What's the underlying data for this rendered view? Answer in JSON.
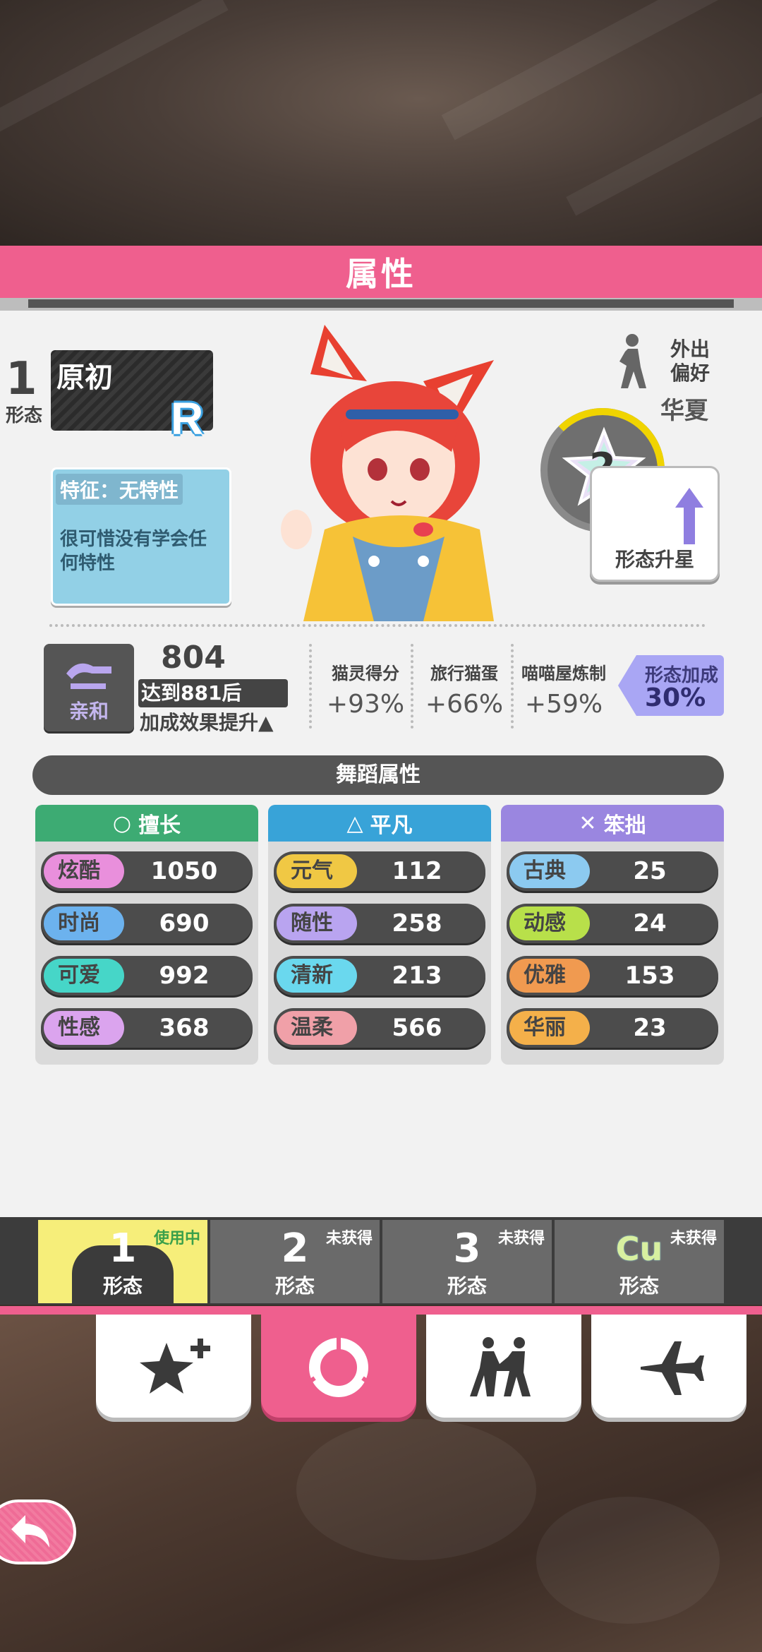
{
  "header": {
    "title": "属性"
  },
  "form": {
    "number": "1",
    "label": "形态",
    "name": "原初",
    "rarity": "R",
    "trait_title": "特征：无特性",
    "trait_desc": "很可惜没有学会任何特性"
  },
  "preference": {
    "label": "外出偏好",
    "value": "华夏",
    "star_level": "2",
    "upgrade_label": "形态升星"
  },
  "affinity": {
    "label": "亲和",
    "value": "804",
    "threshold": "达到881后",
    "bonus_text": "加成效果提升▲"
  },
  "bonuses": [
    {
      "label": "猫灵得分",
      "value": "+93%"
    },
    {
      "label": "旅行猫蛋",
      "value": "+66%"
    },
    {
      "label": "喵喵屋炼制",
      "value": "+59%"
    }
  ],
  "form_bonus": {
    "label": "形态加成",
    "value": "30%"
  },
  "dance": {
    "title": "舞蹈属性",
    "columns": [
      {
        "header": "擅长",
        "icon": "○",
        "color": "#3dab73",
        "stats": [
          {
            "name": "炫酷",
            "value": "1050",
            "color": "#e98fdc"
          },
          {
            "name": "时尚",
            "value": "690",
            "color": "#6cb2ee"
          },
          {
            "name": "可爱",
            "value": "992",
            "color": "#46d6c8"
          },
          {
            "name": "性感",
            "value": "368",
            "color": "#dba4ee"
          }
        ]
      },
      {
        "header": "平凡",
        "icon": "△",
        "color": "#38a3d8",
        "stats": [
          {
            "name": "元气",
            "value": "112",
            "color": "#f0c844"
          },
          {
            "name": "随性",
            "value": "258",
            "color": "#b9a4f0"
          },
          {
            "name": "清新",
            "value": "213",
            "color": "#6ad8ee"
          },
          {
            "name": "温柔",
            "value": "566",
            "color": "#f0a0a8"
          }
        ]
      },
      {
        "header": "笨拙",
        "icon": "✕",
        "color": "#9a86e0",
        "stats": [
          {
            "name": "古典",
            "value": "25",
            "color": "#8ccaf0"
          },
          {
            "name": "动感",
            "value": "24",
            "color": "#b8e04a"
          },
          {
            "name": "优雅",
            "value": "153",
            "color": "#f09a50"
          },
          {
            "name": "华丽",
            "value": "23",
            "color": "#f4b04a"
          }
        ]
      }
    ]
  },
  "form_tabs": [
    {
      "num": "1",
      "label": "形态",
      "status": "使用中"
    },
    {
      "num": "2",
      "label": "形态",
      "status": "未获得"
    },
    {
      "num": "3",
      "label": "形态",
      "status": "未获得"
    },
    {
      "num": "Cu",
      "label": "形态",
      "status": "未获得"
    }
  ],
  "nav": [
    "star-plus-icon",
    "ring-icon",
    "dance-icon",
    "plane-icon"
  ],
  "colors": {
    "accent": "#ef5f8e"
  }
}
